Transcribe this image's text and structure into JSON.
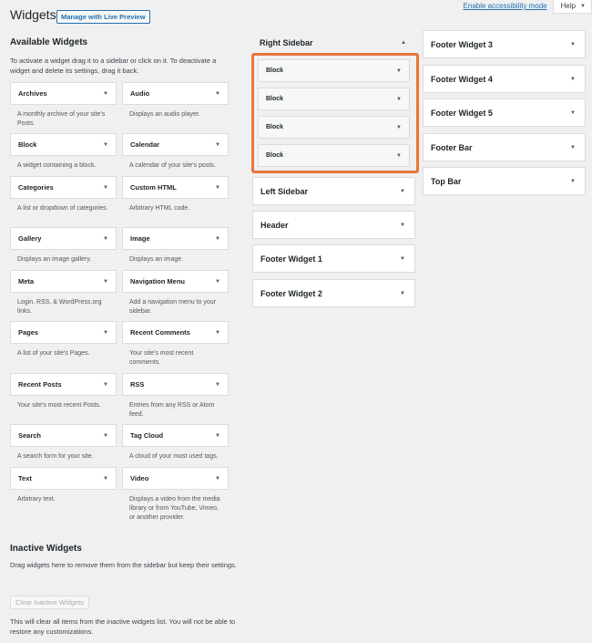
{
  "header": {
    "title": "Widgets",
    "live_preview_label": "Manage with Live Preview",
    "accessibility_link": "Enable accessibility mode",
    "help_label": "Help"
  },
  "available": {
    "title": "Available Widgets",
    "description": "To activate a widget drag it to a sidebar or click on it. To deactivate a widget and delete its settings, drag it back.",
    "widgets": [
      {
        "name": "Archives",
        "desc": "A monthly archive of your site's Posts."
      },
      {
        "name": "Audio",
        "desc": "Displays an audio player."
      },
      {
        "name": "Block",
        "desc": "A widget containing a block."
      },
      {
        "name": "Calendar",
        "desc": "A calendar of your site's posts."
      },
      {
        "name": "Categories",
        "desc": "A list or dropdown of categories."
      },
      {
        "name": "Custom HTML",
        "desc": "Arbitrary HTML code."
      },
      {
        "name": "Gallery",
        "desc": "Displays an image gallery."
      },
      {
        "name": "Image",
        "desc": "Displays an image."
      },
      {
        "name": "Meta",
        "desc": "Login, RSS, & WordPress.org links."
      },
      {
        "name": "Navigation Menu",
        "desc": "Add a navigation menu to your sidebar."
      },
      {
        "name": "Pages",
        "desc": "A list of your site's Pages."
      },
      {
        "name": "Recent Comments",
        "desc": "Your site's most recent comments."
      },
      {
        "name": "Recent Posts",
        "desc": "Your site's most recent Posts."
      },
      {
        "name": "RSS",
        "desc": "Entries from any RSS or Atom feed."
      },
      {
        "name": "Search",
        "desc": "A search form for your site."
      },
      {
        "name": "Tag Cloud",
        "desc": "A cloud of your most used tags."
      },
      {
        "name": "Text",
        "desc": "Arbitrary text."
      },
      {
        "name": "Video",
        "desc": "Displays a video from the media library or from YouTube, Vimeo, or another provider."
      }
    ]
  },
  "inactive": {
    "title": "Inactive Widgets",
    "description": "Drag widgets here to remove them from the sidebar but keep their settings.",
    "clear_label": "Clear Inactive Widgets",
    "note": "This will clear all items from the inactive widgets list. You will not be able to restore any customizations."
  },
  "right_sidebar": {
    "title": "Right Sidebar",
    "blocks": [
      "Block",
      "Block",
      "Block",
      "Block"
    ]
  },
  "sidebars_mid": [
    "Left Sidebar",
    "Header",
    "Footer Widget 1",
    "Footer Widget 2"
  ],
  "sidebars_right": [
    "Footer Widget 3",
    "Footer Widget 4",
    "Footer Widget 5",
    "Footer Bar",
    "Top Bar"
  ],
  "colors": {
    "accent": "#2271b1",
    "highlight": "#e8763a",
    "background": "#f0f0f1"
  }
}
